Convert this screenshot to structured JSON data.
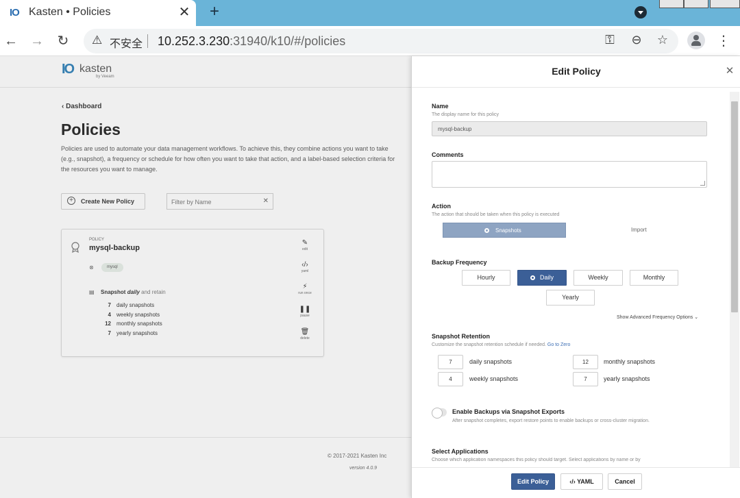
{
  "browser": {
    "tab_favicon": "IO",
    "tab_title": "Kasten • Policies",
    "tab_close": "✕",
    "new_tab": "+",
    "insecure_label": "不安全",
    "url_host": "10.252.3.230",
    "url_rest": ":31940/k10/#/policies",
    "icons": [
      "back-arrow-icon",
      "forward-arrow-icon",
      "reload-icon",
      "warning-icon",
      "key-icon",
      "zoom-icon",
      "star-icon",
      "profile-icon",
      "menu-icon"
    ]
  },
  "app": {
    "logo_mark": "IO",
    "logo_word": "kasten",
    "logo_sub": "by Veeam",
    "back_link": "‹ Dashboard",
    "title": "Policies",
    "description": "Policies are used to automate your data management workflows. To achieve this, they combine actions you want to take (e.g., snapshot), a frequency or schedule for how often you want to take that action, and a label-based selection criteria for the resources you want to manage.",
    "create_button": "Create New Policy",
    "filter_placeholder": "Filter by Name",
    "policy_card": {
      "kicker": "POLICY",
      "name": "mysql-backup",
      "namespace": "mysql",
      "schedule_prefix": "Snapshot",
      "schedule_freq": "daily",
      "schedule_suffix": "and retain",
      "retention": [
        {
          "count": "7",
          "label": "daily snapshots"
        },
        {
          "count": "4",
          "label": "weekly snapshots"
        },
        {
          "count": "12",
          "label": "monthly snapshots"
        },
        {
          "count": "7",
          "label": "yearly snapshots"
        }
      ],
      "actions": [
        {
          "label": "edit",
          "icon": "edit-icon"
        },
        {
          "label": "yaml",
          "icon": "code-icon"
        },
        {
          "label": "run once",
          "icon": "run-icon"
        },
        {
          "label": "pause",
          "icon": "pause-icon"
        },
        {
          "label": "delete",
          "icon": "trash-icon"
        }
      ]
    },
    "copyright": "© 2017-2021 Kasten Inc",
    "version": "version 4.0.9"
  },
  "panel": {
    "title": "Edit Policy",
    "name_label": "Name",
    "name_help": "The display name for this policy",
    "name_value": "mysql-backup",
    "comments_label": "Comments",
    "comments_value": "",
    "action_label": "Action",
    "action_help": "The action that should be taken when this policy is executed",
    "action_options": [
      "Snapshots",
      "Import"
    ],
    "action_selected": "Snapshots",
    "frequency_label": "Backup Frequency",
    "frequency_options": [
      "Hourly",
      "Daily",
      "Weekly",
      "Monthly",
      "Yearly"
    ],
    "frequency_selected": "Daily",
    "advanced_link": "Show Advanced Frequency Options ⌄",
    "retention_label": "Snapshot Retention",
    "retention_help": "Customize the snapshot retention schedule if needed.",
    "retention_goto": "Go to Zero",
    "retention": {
      "daily": {
        "value": "7",
        "label": "daily snapshots"
      },
      "weekly": {
        "value": "4",
        "label": "weekly snapshots"
      },
      "monthly": {
        "value": "12",
        "label": "monthly snapshots"
      },
      "yearly": {
        "value": "7",
        "label": "yearly snapshots"
      }
    },
    "exports_label": "Enable Backups via Snapshot Exports",
    "exports_help": "After snapshot completes, export restore points to enable backups or cross-cluster migration.",
    "exports_enabled": false,
    "apps_label": "Select Applications",
    "apps_help": "Choose which application namespaces this policy should target. Select applications by name or by",
    "buttons": {
      "submit": "Edit Policy",
      "yaml": "YAML",
      "cancel": "Cancel"
    }
  },
  "colors": {
    "primary": "#3b5f97",
    "action_selected": "#8ea4c2",
    "tabbar": "#6ab4d8"
  }
}
